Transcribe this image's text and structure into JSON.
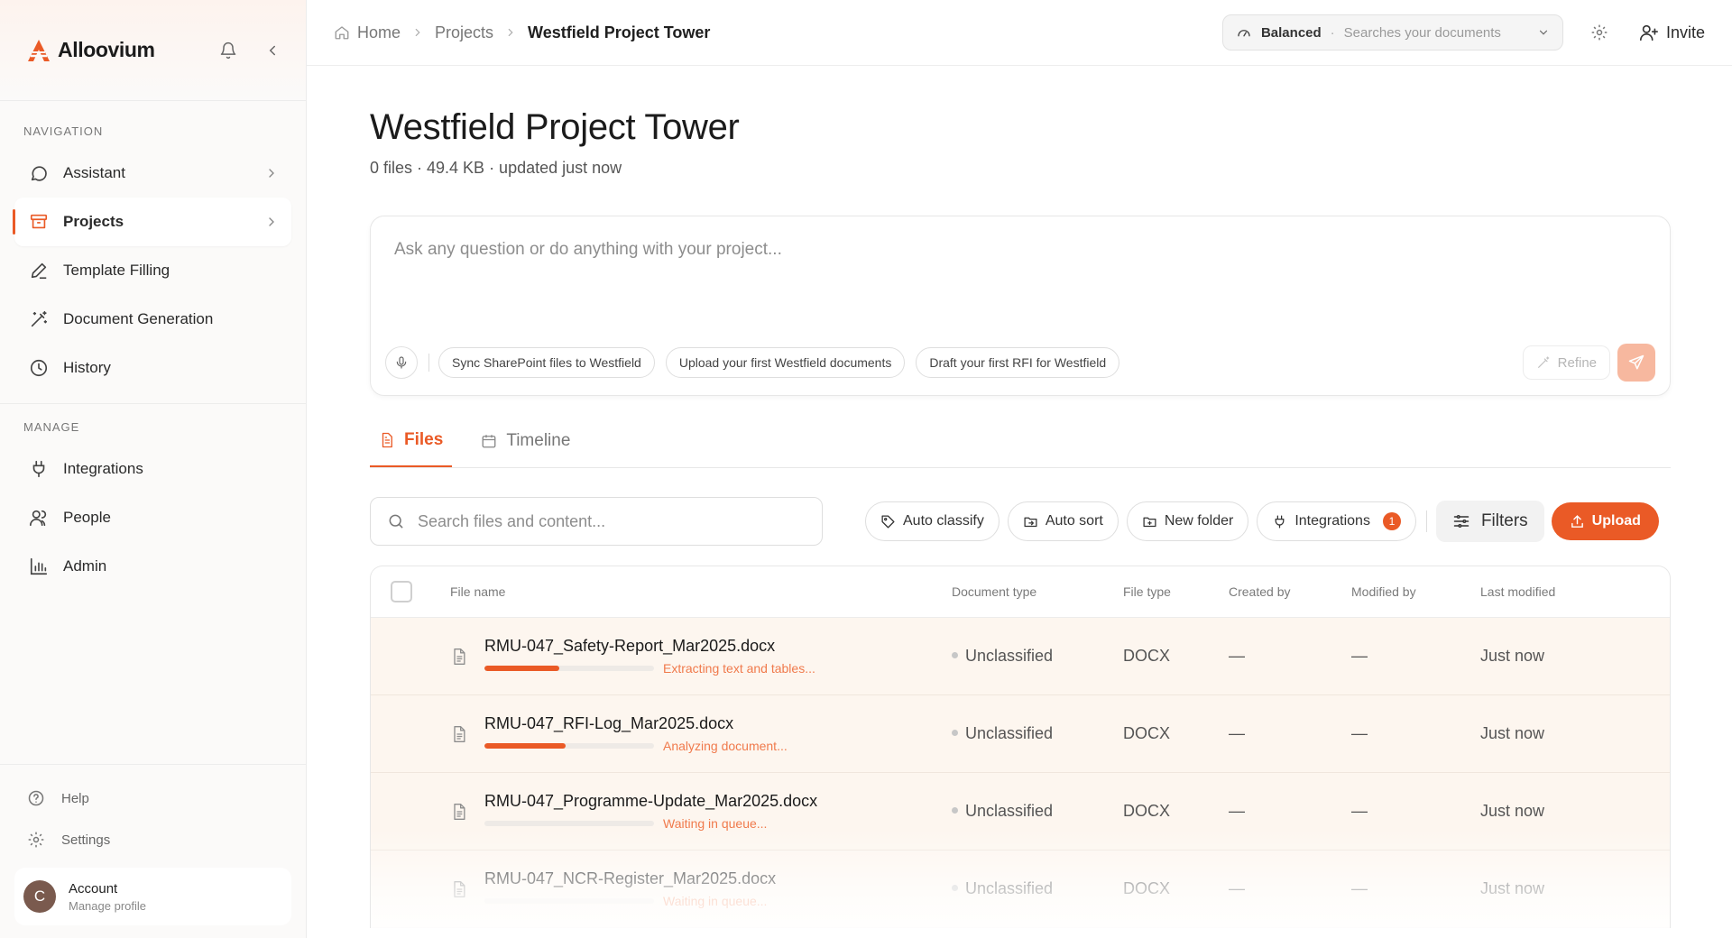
{
  "brand": {
    "name": "Alloovium",
    "accent": "#ea5a26"
  },
  "sidebar": {
    "nav_label": "NAVIGATION",
    "nav_items": [
      {
        "label": "Assistant",
        "icon": "chat-bubble-icon"
      },
      {
        "label": "Projects",
        "icon": "archive-box-icon",
        "active": true
      },
      {
        "label": "Template Filling",
        "icon": "pencil-icon"
      },
      {
        "label": "Document Generation",
        "icon": "magic-wand-icon"
      },
      {
        "label": "History",
        "icon": "clock-icon"
      }
    ],
    "manage_label": "MANAGE",
    "manage_items": [
      {
        "label": "Integrations",
        "icon": "plug-icon"
      },
      {
        "label": "People",
        "icon": "users-icon"
      },
      {
        "label": "Admin",
        "icon": "bar-chart-icon"
      }
    ],
    "help_label": "Help",
    "settings_label": "Settings",
    "account": {
      "initial": "C",
      "name": "Account",
      "sub": "Manage profile"
    }
  },
  "topbar": {
    "crumbs": [
      "Home",
      "Projects",
      "Westfield Project Tower"
    ],
    "mode": "Balanced",
    "mode_dot": "·",
    "mode_desc": "Searches your documents",
    "invite_label": "Invite"
  },
  "project": {
    "title": "Westfield Project Tower",
    "meta": "0 files · 49.4 KB · updated just now"
  },
  "composer": {
    "placeholder": "Ask any question or do anything with your project...",
    "chips": [
      "Sync SharePoint files to Westfield",
      "Upload your first Westfield documents",
      "Draft your first RFI for Westfield"
    ],
    "refine_label": "Refine"
  },
  "tabs": [
    {
      "label": "Files",
      "active": true
    },
    {
      "label": "Timeline"
    }
  ],
  "toolbar": {
    "search_placeholder": "Search files and content...",
    "auto_classify": "Auto classify",
    "auto_sort": "Auto sort",
    "new_folder": "New folder",
    "integrations": "Integrations",
    "integrations_badge": "1",
    "filters": "Filters",
    "upload": "Upload"
  },
  "table": {
    "headers": [
      "File name",
      "Document type",
      "File type",
      "Created by",
      "Modified by",
      "Last modified"
    ],
    "rows": [
      {
        "name": "RMU-047_Safety-Report_Mar2025.docx",
        "progress": 0.44,
        "status": "Extracting text and tables...",
        "doc_type": "Unclassified",
        "file_type": "DOCX",
        "created_by": "—",
        "modified_by": "—",
        "last_modified": "Just now"
      },
      {
        "name": "RMU-047_RFI-Log_Mar2025.docx",
        "progress": 0.48,
        "status": "Analyzing document...",
        "doc_type": "Unclassified",
        "file_type": "DOCX",
        "created_by": "—",
        "modified_by": "—",
        "last_modified": "Just now"
      },
      {
        "name": "RMU-047_Programme-Update_Mar2025.docx",
        "progress": 0.0,
        "status": "Waiting in queue...",
        "doc_type": "Unclassified",
        "file_type": "DOCX",
        "created_by": "—",
        "modified_by": "—",
        "last_modified": "Just now"
      },
      {
        "name": "RMU-047_NCR-Register_Mar2025.docx",
        "progress": 0.0,
        "status": "Waiting in queue...",
        "doc_type": "Unclassified",
        "file_type": "DOCX",
        "created_by": "—",
        "modified_by": "—",
        "last_modified": "Just now"
      }
    ]
  }
}
